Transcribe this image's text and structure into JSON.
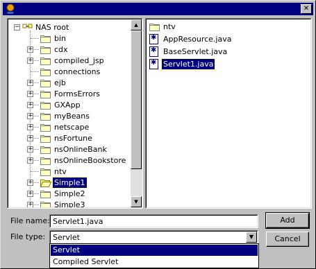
{
  "titlebar": {
    "title": "",
    "icon": "java-cup-icon",
    "close_label": "✕"
  },
  "tree": {
    "root": "NAS root",
    "items": [
      {
        "label": "bin",
        "expandable": false
      },
      {
        "label": "cdx",
        "expandable": true
      },
      {
        "label": "compiled_jsp",
        "expandable": true
      },
      {
        "label": "connections",
        "expandable": false
      },
      {
        "label": "ejb",
        "expandable": true
      },
      {
        "label": "FormsErrors",
        "expandable": true
      },
      {
        "label": "GXApp",
        "expandable": true
      },
      {
        "label": "myBeans",
        "expandable": true
      },
      {
        "label": "netscape",
        "expandable": true
      },
      {
        "label": "nsFortune",
        "expandable": true
      },
      {
        "label": "nsOnlineBank",
        "expandable": true
      },
      {
        "label": "nsOnlineBookstore",
        "expandable": true
      },
      {
        "label": "ntv",
        "expandable": false
      },
      {
        "label": "Simple1",
        "expandable": true,
        "selected": true
      },
      {
        "label": "Simple2",
        "expandable": true
      },
      {
        "label": "Simple3",
        "expandable": true
      }
    ]
  },
  "file_list": [
    {
      "label": "ntv",
      "type": "folder"
    },
    {
      "label": "AppResource.java",
      "type": "java-file"
    },
    {
      "label": "BaseServlet.java",
      "type": "java-file"
    },
    {
      "label": "Servlet1.java",
      "type": "java-file",
      "selected": true
    }
  ],
  "form": {
    "file_name_label": "File name:",
    "file_name_value": "Servlet1.java",
    "file_type_label": "File type:",
    "file_type_value": "Servlet",
    "file_type_options": [
      "Servlet",
      "Compiled Servlet"
    ]
  },
  "buttons": {
    "add": "Add",
    "cancel": "Cancel"
  },
  "colors": {
    "selection": "#000080",
    "titlebar": "#000080",
    "face": "#c0c0c0"
  }
}
